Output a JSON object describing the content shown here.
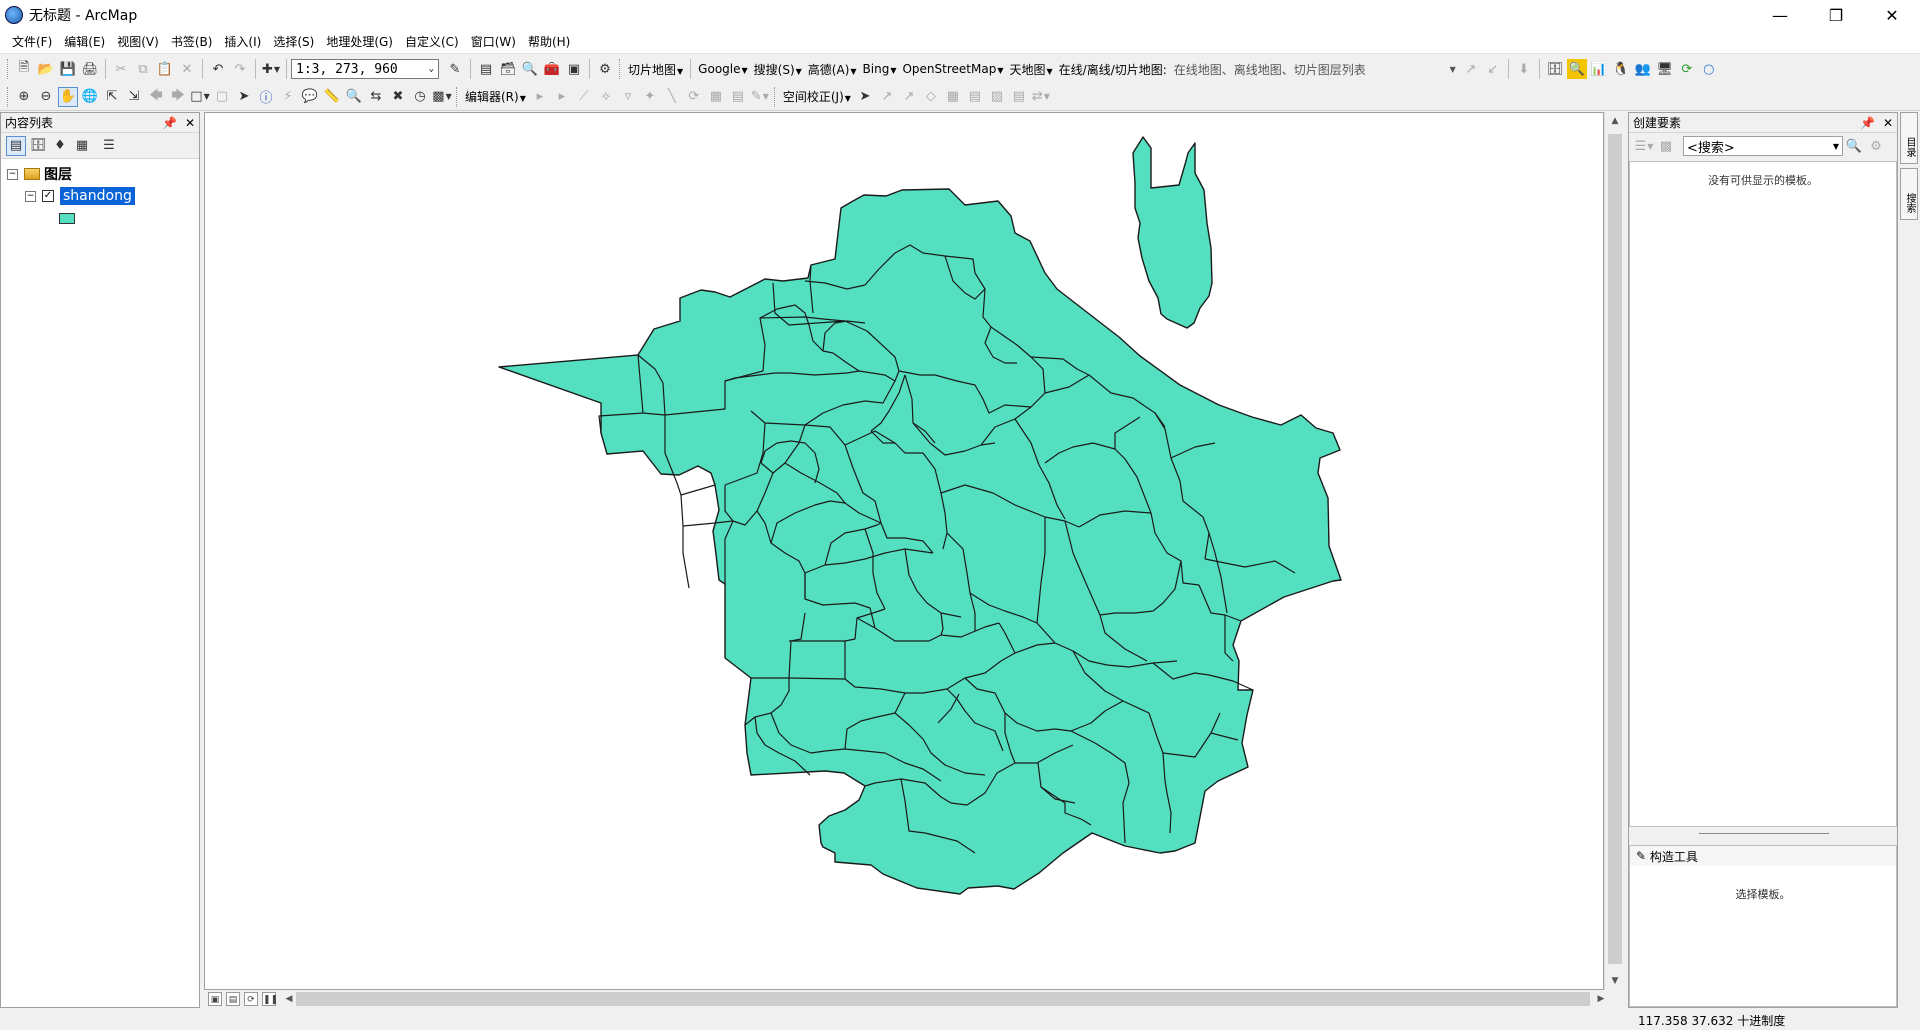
{
  "window": {
    "title": "无标题 - ArcMap"
  },
  "menu": [
    "文件(F)",
    "编辑(E)",
    "视图(V)",
    "书签(B)",
    "插入(I)",
    "选择(S)",
    "地理处理(G)",
    "自定义(C)",
    "窗口(W)",
    "帮助(H)"
  ],
  "toolbar1": {
    "scale": "1:3, 273, 960",
    "tile_map": "切片地图",
    "google": "Google",
    "sogou": "搜搜(S)",
    "gaode": "高德(A)",
    "bing": "Bing",
    "osm": "OpenStreetMap",
    "tianditu": "天地图",
    "online_label": "在线/离线/切片地图:",
    "online_combo": "在线地图、离线地图、切片图层列表"
  },
  "toolbar2": {
    "editor": "编辑器(R)",
    "spatial_adjust": "空间校正(J)"
  },
  "toc": {
    "title": "内容列表",
    "group": "图层",
    "layer": "shandong",
    "fill_color": "#54e0c0"
  },
  "right_panel": {
    "title": "创建要素",
    "search_placeholder": "<搜索>",
    "no_template_msg": "没有可供显示的模板。",
    "construct_tools": "构造工具",
    "select_template_msg": "选择模板。"
  },
  "side_tabs": [
    "目录",
    "搜索"
  ],
  "status": {
    "coords": "117.358  37.632 十进制度"
  }
}
